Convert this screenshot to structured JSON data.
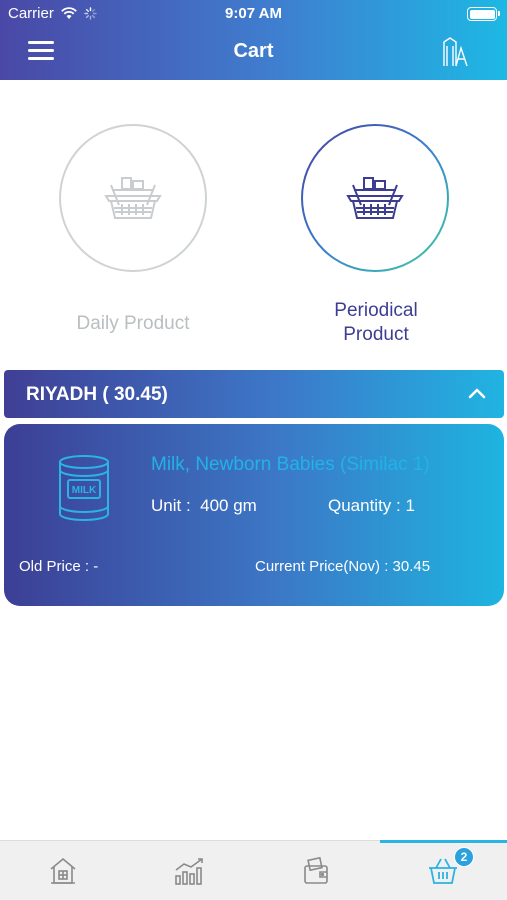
{
  "status_bar": {
    "carrier": "Carrier",
    "time": "9:07 AM"
  },
  "header": {
    "title": "Cart"
  },
  "categories": [
    {
      "label": "Daily Product",
      "selected": false,
      "icon": "basket-icon"
    },
    {
      "label": "Periodical Product",
      "selected": true,
      "icon": "basket-icon"
    }
  ],
  "city": {
    "label": "RIYADH ( 30.45)",
    "expanded": true
  },
  "item": {
    "name": "Milk, Newborn Babies (Similac 1)",
    "icon_text": "MILK",
    "unit_label": "Unit :",
    "unit_value": "400 gm",
    "quantity_label": "Quantity :",
    "quantity_value": "1",
    "old_price_label": "Old Price :",
    "old_price_value": "-",
    "current_price_label": "Current Price(Nov) :",
    "current_price_value": "30.45"
  },
  "tabbar": {
    "tabs": [
      {
        "icon": "home-icon",
        "active": false
      },
      {
        "icon": "chart-icon",
        "active": false
      },
      {
        "icon": "wallet-icon",
        "active": false
      },
      {
        "icon": "cart-basket-icon",
        "active": true,
        "badge": "2"
      }
    ]
  },
  "colors": {
    "gradient_start": "#3f3f95",
    "gradient_end": "#1eb4e0",
    "active_label": "#3d3e93",
    "inactive_label": "#b9bec0",
    "product_name": "#22b2e6"
  }
}
